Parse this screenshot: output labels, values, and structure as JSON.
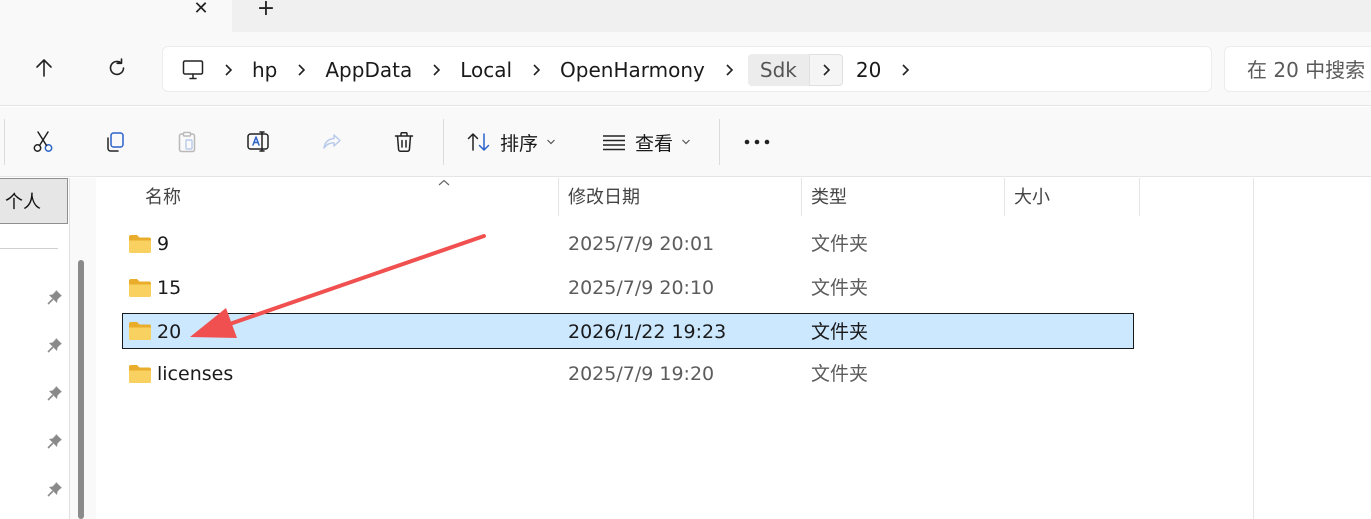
{
  "tabs": {
    "close_glyph": "✕",
    "new_tab_glyph": "+"
  },
  "navigation": {
    "breadcrumbs": [
      "hp",
      "AppData",
      "Local",
      "OpenHarmony",
      "Sdk",
      "20"
    ],
    "search_placeholder": "在 20 中搜索"
  },
  "toolbar": {
    "sort_label": "排序",
    "view_label": "查看"
  },
  "sidebar": {
    "personal_label": "个人",
    "pinned_count": 5
  },
  "file_list": {
    "columns": {
      "name": "名称",
      "modified": "修改日期",
      "type": "类型",
      "size": "大小"
    },
    "rows": [
      {
        "name": "9",
        "modified": "2025/7/9 20:01",
        "type": "文件夹",
        "selected": false
      },
      {
        "name": "15",
        "modified": "2025/7/9 20:10",
        "type": "文件夹",
        "selected": false
      },
      {
        "name": "20",
        "modified": "2026/1/22 19:23",
        "type": "文件夹",
        "selected": true
      },
      {
        "name": "licenses",
        "modified": "2025/7/9 19:20",
        "type": "文件夹",
        "selected": false
      }
    ]
  },
  "colors": {
    "selection_fill": "#cce8ff",
    "annotation_arrow": "#f0504f",
    "folder_yellow": "#f7c948"
  }
}
